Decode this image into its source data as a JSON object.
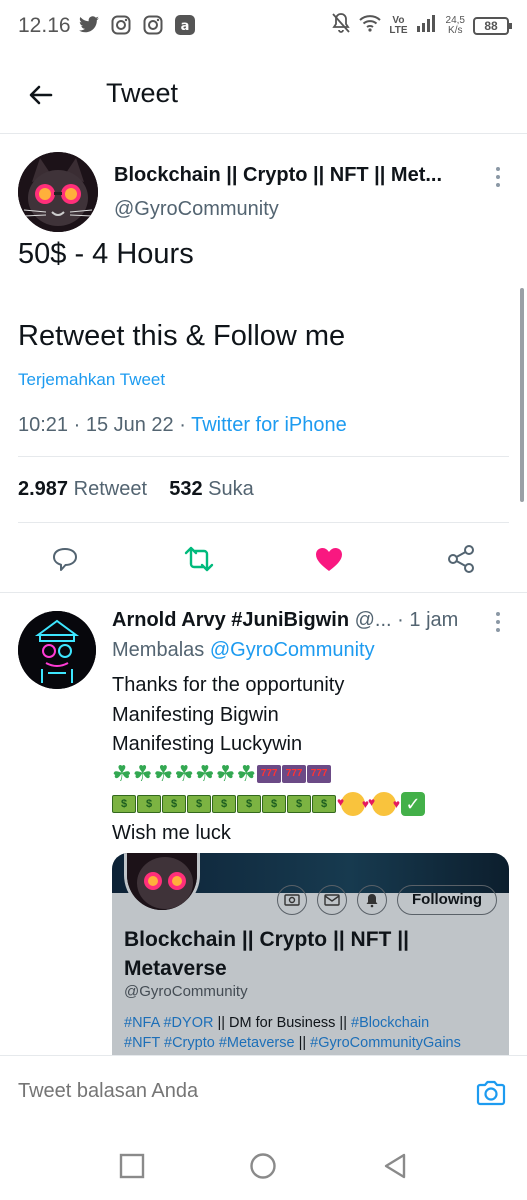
{
  "status_bar": {
    "time": "12.16",
    "network_top": "Vo",
    "network_bottom": "LTE",
    "speed_value": "24,5",
    "speed_unit": "K/s",
    "battery": "88"
  },
  "header": {
    "title": "Tweet"
  },
  "main_tweet": {
    "author_name": "Blockchain || Crypto || NFT || Met...",
    "author_handle": "@GyroCommunity",
    "text_line1": "50$ - 4 Hours",
    "text_line2": "Retweet this & Follow me",
    "translate_label": "Terjemahkan Tweet",
    "time_date": "10:21 · 15 Jun 22 · ",
    "source": "Twitter for iPhone",
    "retweet_count": "2.987",
    "retweet_label": "Retweet",
    "like_count": "532",
    "like_label": "Suka",
    "accent_color": "#1d9bf0",
    "retweet_color": "#00ba7c",
    "like_color": "#f91880"
  },
  "reply": {
    "author_name": "Arnold Arvy #JuniBigwin",
    "author_handle": "@...",
    "time": "· 1 jam",
    "replying_label": "Membalas",
    "replying_to": "@GyroCommunity",
    "lines": [
      "Thanks for the opportunity",
      "Manifesting Bigwin",
      "Manifesting Luckywin"
    ],
    "last_line": "Wish me luck",
    "slot_text": "777",
    "money_text": "$",
    "check_text": "✓",
    "embed": {
      "following_label": "Following",
      "name": "Blockchain || Crypto || NFT || Metaverse",
      "handle": "@GyroCommunity",
      "bio_tags1": "#NFA #DYOR",
      "bio_mid": " || DM for Business || ",
      "bio_tag2": "#Blockchain",
      "bio_tags3": "#NFT #Crypto #Metaverse",
      "bio_sep": " || ",
      "bio_tag4": "#GyroCommunityGains"
    }
  },
  "composer": {
    "placeholder": "Tweet balasan Anda"
  }
}
